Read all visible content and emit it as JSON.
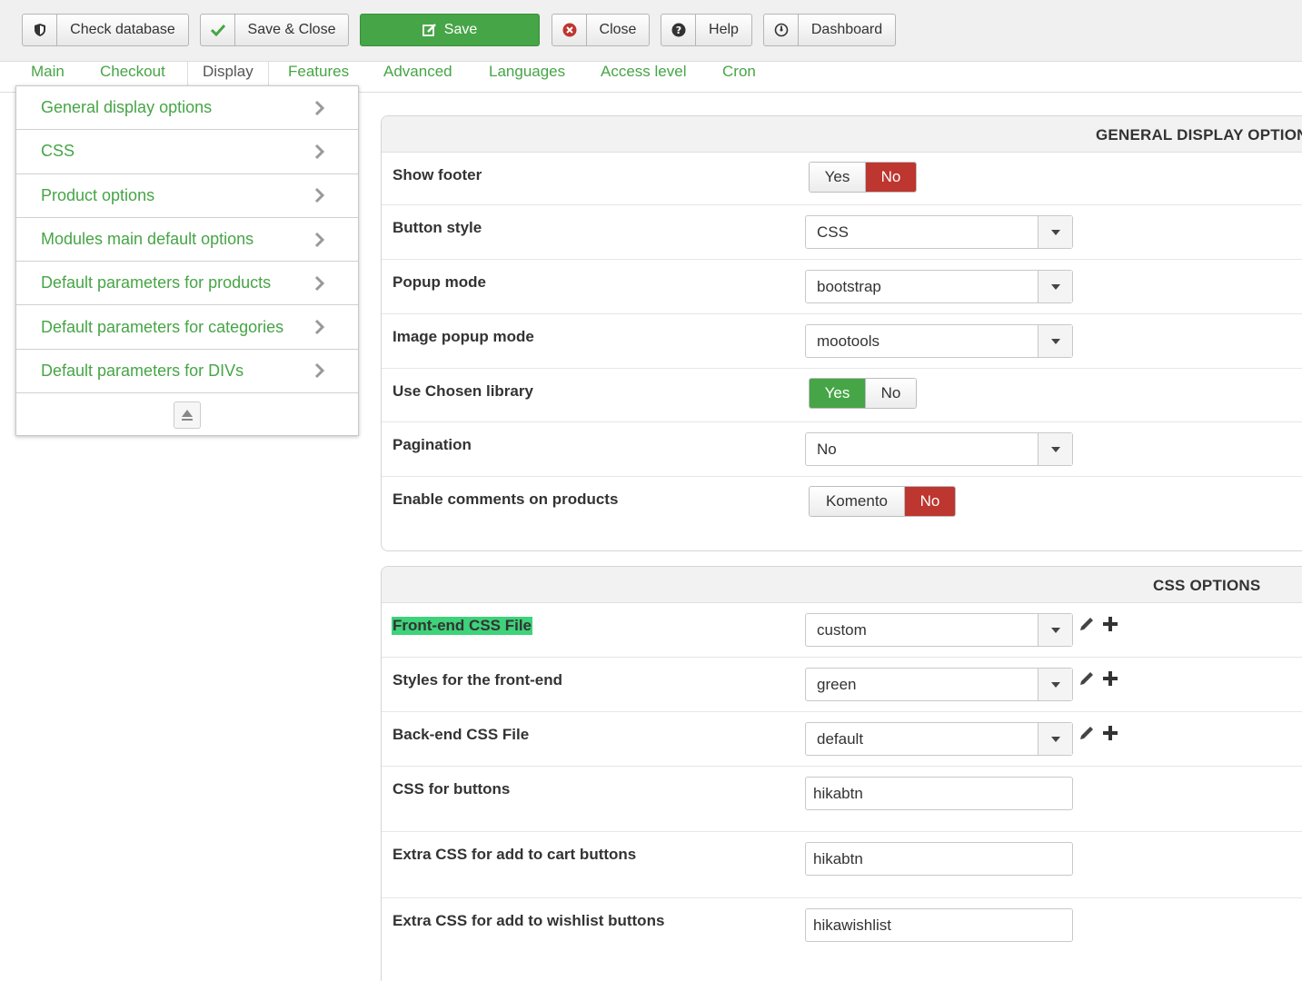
{
  "toolbar": {
    "check_database": "Check database",
    "save_close": "Save & Close",
    "save": "Save",
    "close": "Close",
    "help": "Help",
    "dashboard": "Dashboard"
  },
  "tabs": [
    "Main",
    "Checkout",
    "Display",
    "Features",
    "Advanced",
    "Languages",
    "Access level",
    "Cron"
  ],
  "sidebar": {
    "items": [
      "General display options",
      "CSS",
      "Product options",
      "Modules main default options",
      "Default parameters for products",
      "Default parameters for categories",
      "Default parameters for DIVs"
    ]
  },
  "general": {
    "title": "GENERAL DISPLAY OPTIONS",
    "show_footer": {
      "label": "Show footer",
      "yes": "Yes",
      "no": "No"
    },
    "button_style": {
      "label": "Button style",
      "value": "CSS"
    },
    "popup_mode": {
      "label": "Popup mode",
      "value": "bootstrap"
    },
    "image_popup_mode": {
      "label": "Image popup mode",
      "value": "mootools"
    },
    "use_chosen": {
      "label": "Use Chosen library",
      "yes": "Yes",
      "no": "No"
    },
    "pagination": {
      "label": "Pagination",
      "value": "No"
    },
    "comments": {
      "label": "Enable comments on products",
      "komento": "Komento",
      "no": "No"
    }
  },
  "css": {
    "title": "CSS OPTIONS",
    "frontend_css": {
      "label": "Front-end CSS File",
      "value": "custom"
    },
    "frontend_styles": {
      "label": "Styles for the front-end",
      "value": "green"
    },
    "backend_css": {
      "label": "Back-end CSS File",
      "value": "default"
    },
    "css_buttons": {
      "label": "CSS for buttons",
      "value": "hikabtn"
    },
    "extra_cart": {
      "label": "Extra CSS for add to cart buttons",
      "value": "hikabtn"
    },
    "extra_wishlist": {
      "label": "Extra CSS for add to wishlist buttons",
      "value": "hikawishlist"
    }
  },
  "colors": {
    "accent": "#46a546",
    "danger": "#bd362f",
    "highlight": "#3ed27a"
  }
}
